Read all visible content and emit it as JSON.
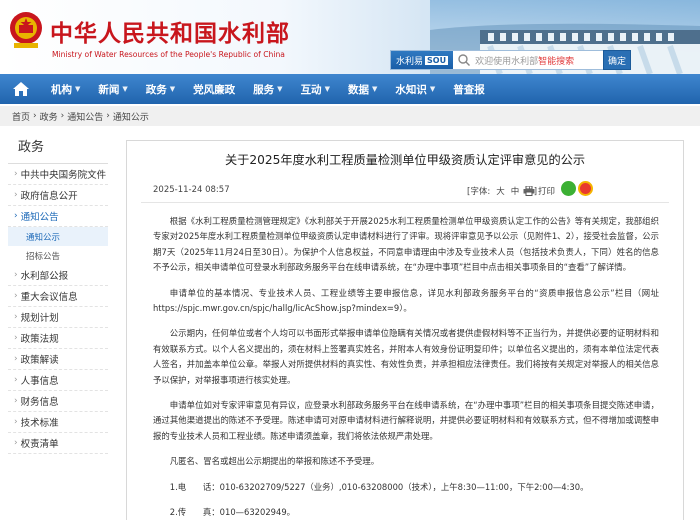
{
  "header": {
    "site_title": "中华人民共和国水利部",
    "site_subtitle": "Ministry of Water Resources of the People's Republic of China",
    "search_brand": "水利易",
    "search_brand_sou": "SOU",
    "search_placeholder_prefix": "欢迎使用水利部",
    "search_placeholder_highlight": "智能搜索",
    "search_button": "确定"
  },
  "nav": {
    "items": [
      {
        "label": "机构",
        "arrow": "▼"
      },
      {
        "label": "新闻",
        "arrow": "▼"
      },
      {
        "label": "政务",
        "arrow": "▼"
      },
      {
        "label": "党风廉政",
        "arrow": ""
      },
      {
        "label": "服务",
        "arrow": "▼"
      },
      {
        "label": "互动",
        "arrow": "▼"
      },
      {
        "label": "数据",
        "arrow": "▼"
      },
      {
        "label": "水知识",
        "arrow": "▼"
      },
      {
        "label": "普查报",
        "arrow": ""
      }
    ]
  },
  "breadcrumb": [
    "首页",
    "政务",
    "通知公告",
    "通知公示"
  ],
  "sidebar": {
    "title": "政务",
    "items": [
      {
        "label": "中共中央国务院文件"
      },
      {
        "label": "政府信息公开"
      },
      {
        "label": "通知公告"
      },
      {
        "label": "水利部公报"
      },
      {
        "label": "重大会议信息"
      },
      {
        "label": "规划计划"
      },
      {
        "label": "政策法规"
      },
      {
        "label": "政策解读"
      },
      {
        "label": "人事信息"
      },
      {
        "label": "财务信息"
      },
      {
        "label": "技术标准"
      },
      {
        "label": "权责清单"
      }
    ],
    "sub_items": [
      "通知公示",
      "招标公告"
    ],
    "bullet": "›"
  },
  "article": {
    "title": "关于2025年度水利工程质量检测单位甲级资质认定评审意见的公示",
    "date": "2025-11-24 08:57",
    "font_label": "[字体:",
    "font_big": "大",
    "font_mid": "中",
    "font_small": "小]",
    "print": "打印",
    "paragraphs": [
      "根据《水利工程质量检测管理规定》《水利部关于开展2025水利工程质量检测单位甲级资质认定工作的公告》等有关规定，我部组织专家对2025年度水利工程质量检测单位甲级资质认定申请材料进行了评审。现将评审意见予以公示（见附件1、2），接受社会监督，公示期7天（2025年11月24日至30日）。为保护个人信息权益，不同意申请理由中涉及专业技术人员（包括技术负责人，下同）姓名的信息不予公示，相关申请单位可登录水利部政务服务平台在线申请系统，在“办理中事项”栏目中点击相关事项条目的“查看”了解详情。",
      "申请单位的基本情况、专业技术人员、工程业绩等主要申报信息，详见水利部政务服务平台的“资质申报信息公示”栏目（网址https://spjc.mwr.gov.cn/spjc/hallg/licAcShow.jsp?mindex=9）。",
      "公示期内，任何单位或者个人均可以书面形式举报申请单位隐瞒有关情况或者提供虚假材料等不正当行为，并提供必要的证明材料和有效联系方式。以个人名义提出的，须在材料上签署真实姓名，并附本人有效身份证明复印件；以单位名义提出的，须有本单位法定代表人签名，并加盖本单位公章。举报人对所提供材料的真实性、有效性负责，并承担相应法律责任。我们将按有关规定对举报人的相关信息予以保护，对举报事项进行核实处理。",
      "申请单位如对专家评审意见有异议，应登录水利部政务服务平台在线申请系统，在“办理中事项”栏目的相关事项条目提交陈述申请，通过其他渠道提出的陈述不予受理。陈述申请可对原申请材料进行解释说明，并提供必要证明材料和有效联系方式，但不得增加或调整申报的专业技术人员和工程业绩。陈述申请须盖章，我们将依法依规严肃处理。",
      "凡匿名、冒名或超出公示期提出的举报和陈述不予受理。",
      "1.电　　话：010-63202709/5227（业务）,010-63208000（技术），上午8:30—11:00，下午2:00—4:30。",
      "2.传　　真：010—63202949。"
    ]
  },
  "colors": {
    "brand_red": "#c8161d",
    "nav_blue": "#2a6fb4",
    "link_blue": "#1e6ab8"
  }
}
